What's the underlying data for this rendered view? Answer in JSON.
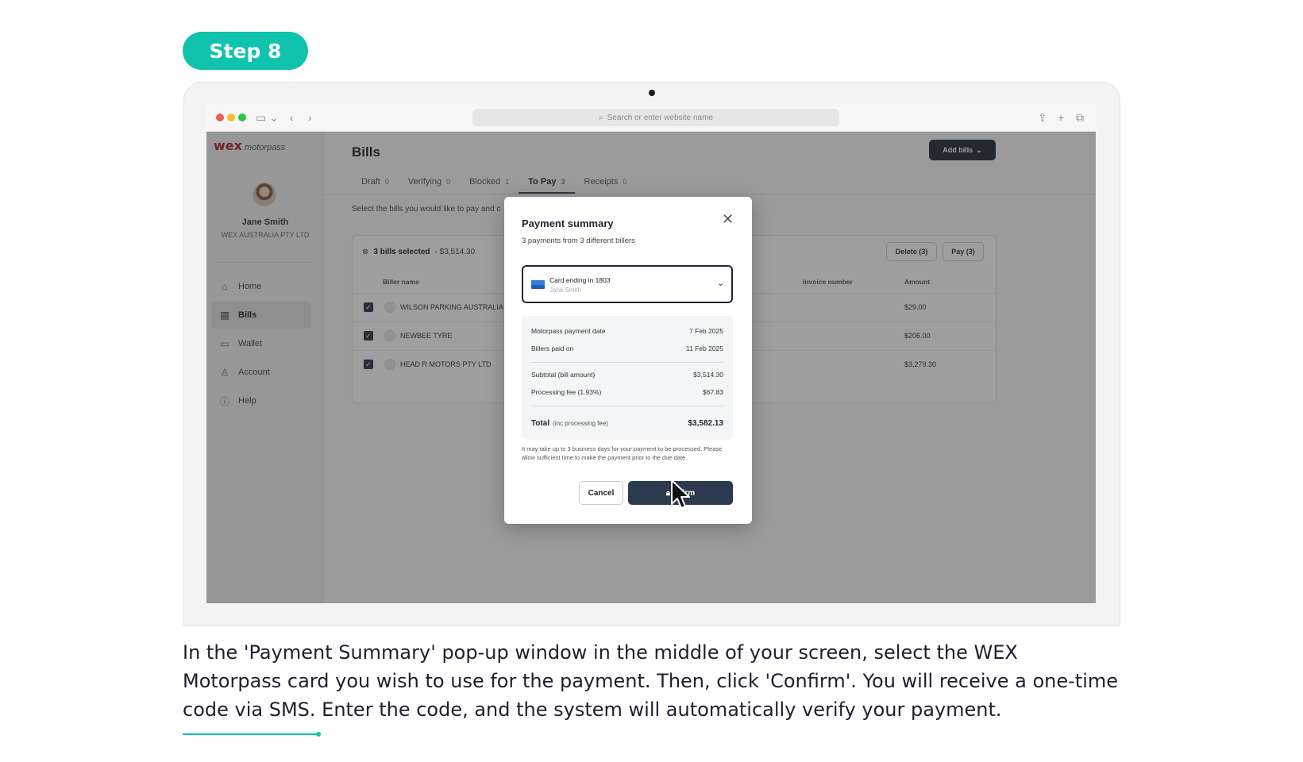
{
  "step_label": "Step 8",
  "browser": {
    "url_placeholder": "Search or enter website name"
  },
  "app": {
    "logo_wex": "wex",
    "logo_motorpass": "motorpass",
    "user": {
      "name": "Jane Smith",
      "company": "WEX AUSTRALIA PTY LTD"
    },
    "nav": [
      {
        "label": "Home",
        "icon": "home-icon",
        "active": false
      },
      {
        "label": "Bills",
        "icon": "document-icon",
        "active": true
      },
      {
        "label": "Wallet",
        "icon": "wallet-icon",
        "active": false
      },
      {
        "label": "Account",
        "icon": "user-icon",
        "active": false
      },
      {
        "label": "Help",
        "icon": "help-icon",
        "active": false
      }
    ],
    "page_title": "Bills",
    "add_bills_label": "Add bills",
    "tabs": [
      {
        "label": "Draft",
        "count": "0"
      },
      {
        "label": "Verifying",
        "count": "0"
      },
      {
        "label": "Blocked",
        "count": "1"
      },
      {
        "label": "To Pay",
        "count": "3",
        "active": true
      },
      {
        "label": "Receipts",
        "count": "0"
      }
    ],
    "instruction": "Select the bills you would like to pay and c",
    "selection": {
      "selected": "3 bills selected",
      "total": "- $3,514.30"
    },
    "delete_label": "Delete (3)",
    "pay_label": "Pay (3)",
    "columns": {
      "biller": "Biller name",
      "invoice": "Invoice number",
      "amount": "Amount"
    },
    "rows": [
      {
        "biller": "WILSON PARKING AUSTRALIA 19",
        "amount": "$29.00"
      },
      {
        "biller": "NEWBEE TYRE",
        "amount": "$206.00"
      },
      {
        "biller": "HEAD R MOTORS PTY LTD",
        "amount": "$3,279.30"
      }
    ]
  },
  "modal": {
    "title": "Payment summary",
    "subtitle": "3 payments from 3 different billers",
    "card_label": "Card ending in 1803",
    "card_holder": "Jane Smith",
    "motorpass_date_label": "Motorpass payment date",
    "motorpass_date": "7 Feb 2025",
    "billers_paid_label": "Billers paid on",
    "billers_paid": "11 Feb 2025",
    "subtotal_label": "Subtotal (bill amount)",
    "subtotal": "$3,514.30",
    "fee_label": "Processing fee (1.93%)",
    "fee": "$67.83",
    "total_label": "Total",
    "total_note": "(inc processing fee)",
    "total": "$3,582.13",
    "disclaimer": "It may take up to 3 business days for your payment to be processed. Please allow sufficient time to make the payment prior to the due date.",
    "cancel_label": "Cancel",
    "confirm_label": "nfirm"
  },
  "caption": "In the 'Payment Summary' pop-up window in the middle of your screen, select the WEX Motorpass card you wish to use for the payment. Then, click 'Confirm'. You will receive a one-time code via SMS. Enter the code, and the system will automatically verify your payment."
}
